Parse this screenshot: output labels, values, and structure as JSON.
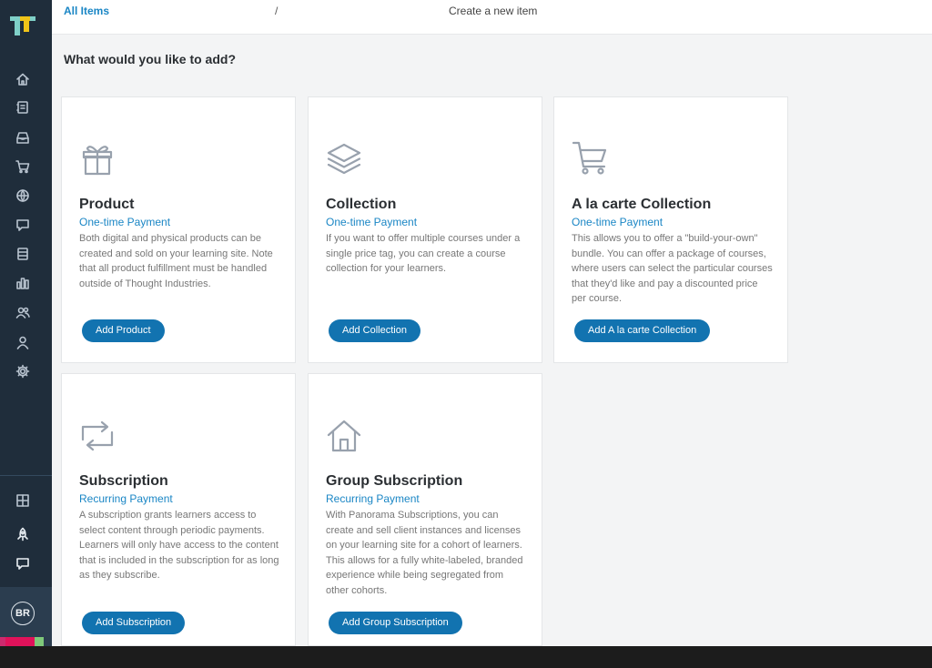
{
  "breadcrumb": {
    "link": "All Items",
    "separator": "/",
    "current": "Create a new item"
  },
  "heading": "What would you like to add?",
  "sidebar": {
    "items": [
      {
        "icon": "home-icon"
      },
      {
        "icon": "content-icon"
      },
      {
        "icon": "inbox-icon"
      },
      {
        "icon": "cart-icon"
      },
      {
        "icon": "globe-icon"
      },
      {
        "icon": "chat-icon"
      },
      {
        "icon": "list-icon"
      },
      {
        "icon": "bar-chart-icon"
      },
      {
        "icon": "users-icon"
      },
      {
        "icon": "user-icon"
      },
      {
        "icon": "gear-icon"
      }
    ],
    "bottom_items": [
      {
        "icon": "grid-icon"
      },
      {
        "icon": "rocket-icon"
      },
      {
        "icon": "help-chat-icon"
      }
    ],
    "avatar_initials": "BR"
  },
  "cards": [
    {
      "icon": "gift-icon",
      "title": "Product",
      "subtitle": "One-time Payment",
      "description": "Both digital and physical products can be created and sold on your learning site. Note that all product fulfillment must be handled outside of Thought Industries.",
      "button": "Add Product"
    },
    {
      "icon": "layers-icon",
      "title": "Collection",
      "subtitle": "One-time Payment",
      "description": "If you want to offer multiple courses under a single price tag, you can create a course collection for your learners.",
      "button": "Add Collection"
    },
    {
      "icon": "cart-icon",
      "title": "A la carte Collection",
      "subtitle": "One-time Payment",
      "description": "This allows you to offer a \"build-your-own\" bundle. You can offer a package of courses, where users can select the particular courses that they'd like and pay a discounted price per course.",
      "button": "Add A la carte Collection"
    },
    {
      "icon": "repeat-icon",
      "title": "Subscription",
      "subtitle": "Recurring Payment",
      "description": "A subscription grants learners access to select content through periodic payments. Learners will only have access to the content that is included in the subscription for as long as they subscribe.",
      "button": "Add Subscription"
    },
    {
      "icon": "house-icon",
      "title": "Group Subscription",
      "subtitle": "Recurring Payment",
      "description": "With Panorama Subscriptions, you can create and sell client instances and licenses on your learning site for a cohort of learners. This allows for a fully white-labeled, branded experience while being segregated from other cohorts.",
      "button": "Add Group Subscription"
    }
  ],
  "colors": {
    "sidebar": "#1f2d3b",
    "accent": "#1a86c5",
    "button": "#1273b0",
    "background": "#f3f4f5"
  }
}
